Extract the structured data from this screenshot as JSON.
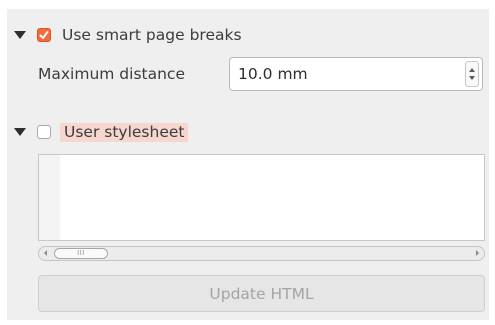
{
  "smart_breaks": {
    "label": "Use smart page breaks",
    "checked": true,
    "expanded": true
  },
  "max_distance": {
    "label": "Maximum distance",
    "value": "10.0 mm"
  },
  "user_stylesheet": {
    "label": "User stylesheet",
    "checked": false,
    "expanded": true,
    "content": ""
  },
  "horizontal_scrollbar": {
    "grip": "III"
  },
  "update_button": {
    "label": "Update HTML",
    "enabled": false
  },
  "colors": {
    "panel_bg": "#efefef",
    "checkbox_accent": "#f36b3b",
    "highlight": "#f7d6cf",
    "disabled_text": "#a4a4a4"
  },
  "icons": {
    "expand": "triangle-down-icon",
    "check": "checkmark-icon",
    "spin_up": "arrow-up-icon",
    "spin_down": "arrow-down-icon"
  }
}
